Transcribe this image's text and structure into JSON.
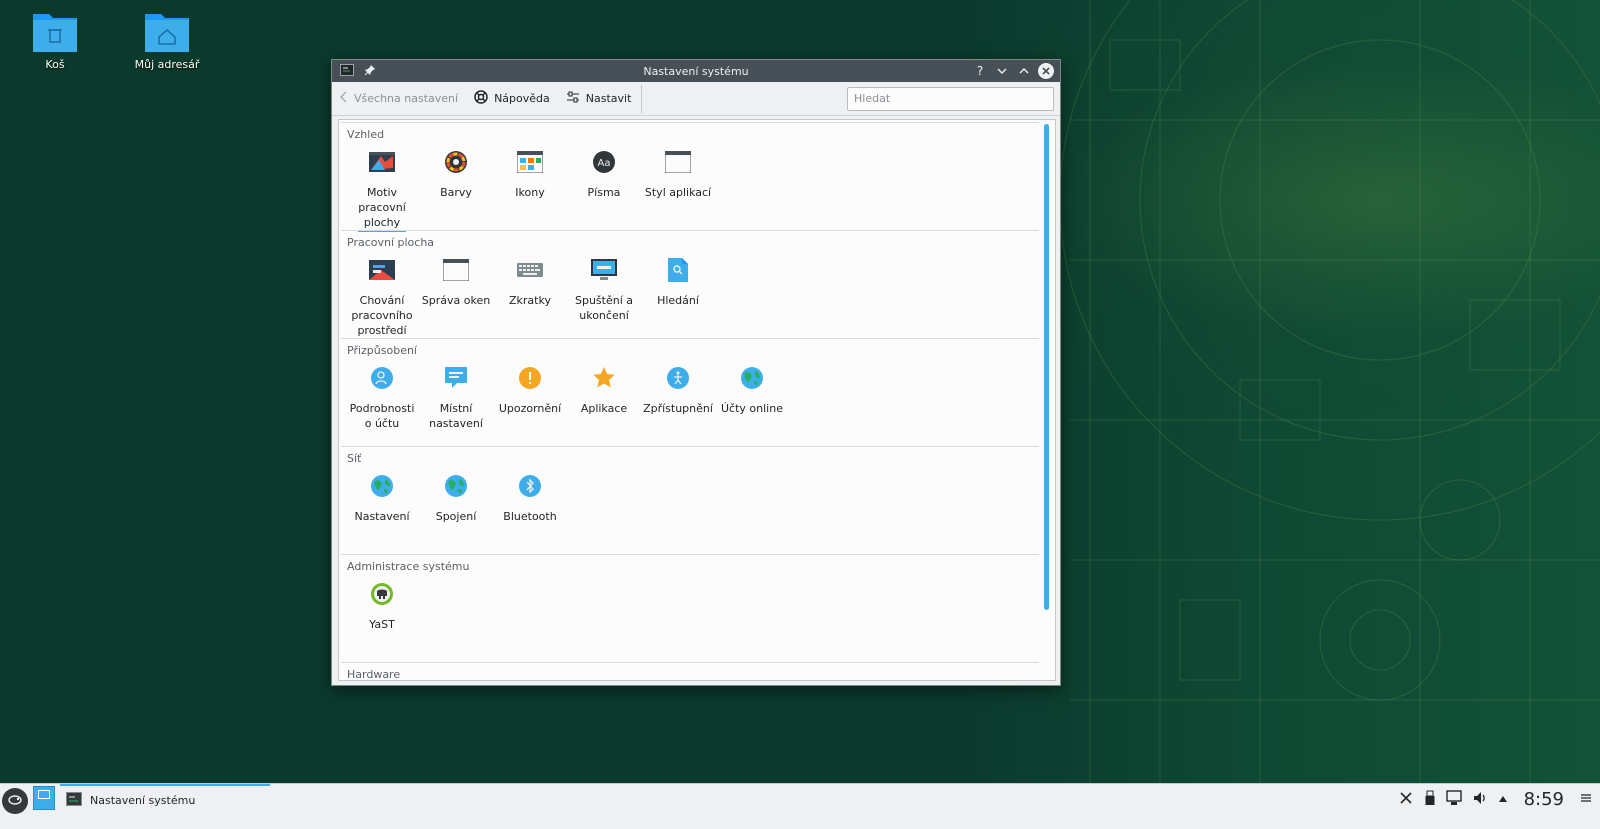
{
  "desktop": {
    "icons": [
      {
        "label": "Koš",
        "icon": "trash-folder-icon"
      },
      {
        "label": "Můj adresář",
        "icon": "home-folder-icon"
      }
    ]
  },
  "window": {
    "title": "Nastavení systému",
    "buttons": [
      "help-icon",
      "minimize-icon",
      "maximize-icon",
      "close-icon"
    ],
    "help_label": "?",
    "toolbar": {
      "back_label": "Všechna nastavení",
      "help_label": "Nápověda",
      "configure_label": "Nastavit",
      "search_placeholder": "Hledat"
    },
    "sections": [
      {
        "title": "Vzhled",
        "items": [
          {
            "l1": "Motiv",
            "l2": "pracovní",
            "l3": "plochy",
            "icon": "workspace-theme-icon",
            "selected": true
          },
          {
            "l1": "Barvy",
            "icon": "colors-icon"
          },
          {
            "l1": "Ikony",
            "icon": "icons-icon"
          },
          {
            "l1": "Písma",
            "icon": "fonts-icon"
          },
          {
            "l1": "Styl aplikací",
            "icon": "app-style-icon"
          }
        ]
      },
      {
        "title": "Pracovní plocha",
        "items": [
          {
            "l1": "Chování",
            "l2": "pracovního",
            "l3": "prostředí",
            "icon": "desktop-behavior-icon"
          },
          {
            "l1": "Správa oken",
            "icon": "window-management-icon"
          },
          {
            "l1": "Zkratky",
            "icon": "keyboard-icon"
          },
          {
            "l1": "Spuštění a",
            "l2": "ukončení",
            "icon": "startup-shutdown-icon"
          },
          {
            "l1": "Hledání",
            "icon": "search-file-icon"
          }
        ]
      },
      {
        "title": "Přizpůsobení",
        "items": [
          {
            "l1": "Podrobnosti",
            "l2": "o účtu",
            "icon": "account-icon"
          },
          {
            "l1": "Místní",
            "l2": "nastavení",
            "icon": "locale-icon"
          },
          {
            "l1": "Upozornění",
            "icon": "notifications-icon"
          },
          {
            "l1": "Aplikace",
            "icon": "applications-star-icon"
          },
          {
            "l1": "Zpřístupnění",
            "icon": "accessibility-icon"
          },
          {
            "l1": "Účty online",
            "icon": "online-accounts-globe-icon"
          }
        ]
      },
      {
        "title": "Síť",
        "items": [
          {
            "l1": "Nastavení",
            "icon": "network-globe-icon"
          },
          {
            "l1": "Spojení",
            "icon": "connections-globe-icon"
          },
          {
            "l1": "Bluetooth",
            "icon": "bluetooth-icon"
          }
        ]
      },
      {
        "title": "Administrace systému",
        "items": [
          {
            "l1": "YaST",
            "icon": "yast-icon"
          }
        ]
      },
      {
        "title": "Hardware",
        "items": []
      }
    ]
  },
  "taskbar": {
    "task_label": "Nastavení systému",
    "clock": "8:59",
    "tray_icons": [
      "kde-connect-icon",
      "usb-device-icon",
      "network-icon",
      "volume-icon",
      "tray-expand-icon",
      "menu-icon"
    ]
  },
  "colors": {
    "accent": "#3daee9",
    "titlebar": "#475057",
    "window_bg": "#eff0f1",
    "desktop": "#0b3a2d"
  }
}
